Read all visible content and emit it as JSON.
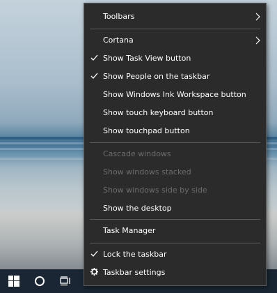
{
  "menu": {
    "items": [
      {
        "label": "Toolbars",
        "submenu": true
      },
      {
        "label": "Cortana",
        "submenu": true
      },
      {
        "label": "Show Task View button",
        "checked": true
      },
      {
        "label": "Show People on the taskbar",
        "checked": true
      },
      {
        "label": "Show Windows Ink Workspace button"
      },
      {
        "label": "Show touch keyboard button"
      },
      {
        "label": "Show touchpad button"
      },
      {
        "label": "Cascade windows",
        "disabled": true
      },
      {
        "label": "Show windows stacked",
        "disabled": true
      },
      {
        "label": "Show windows side by side",
        "disabled": true
      },
      {
        "label": "Show the desktop"
      },
      {
        "label": "Task Manager"
      },
      {
        "label": "Lock the taskbar",
        "checked": true
      },
      {
        "label": "Taskbar settings",
        "icon": "gear-icon"
      }
    ]
  },
  "taskbar": {
    "buttons": [
      {
        "icon": "windows-start-icon"
      },
      {
        "icon": "cortana-circle-icon"
      },
      {
        "icon": "task-view-icon"
      }
    ],
    "background": "#1a2633"
  },
  "colors": {
    "menu_background": "#2b2b2b",
    "menu_border": "#5a5a5a",
    "text": "#ffffff",
    "disabled_text": "#6d6d6d"
  }
}
